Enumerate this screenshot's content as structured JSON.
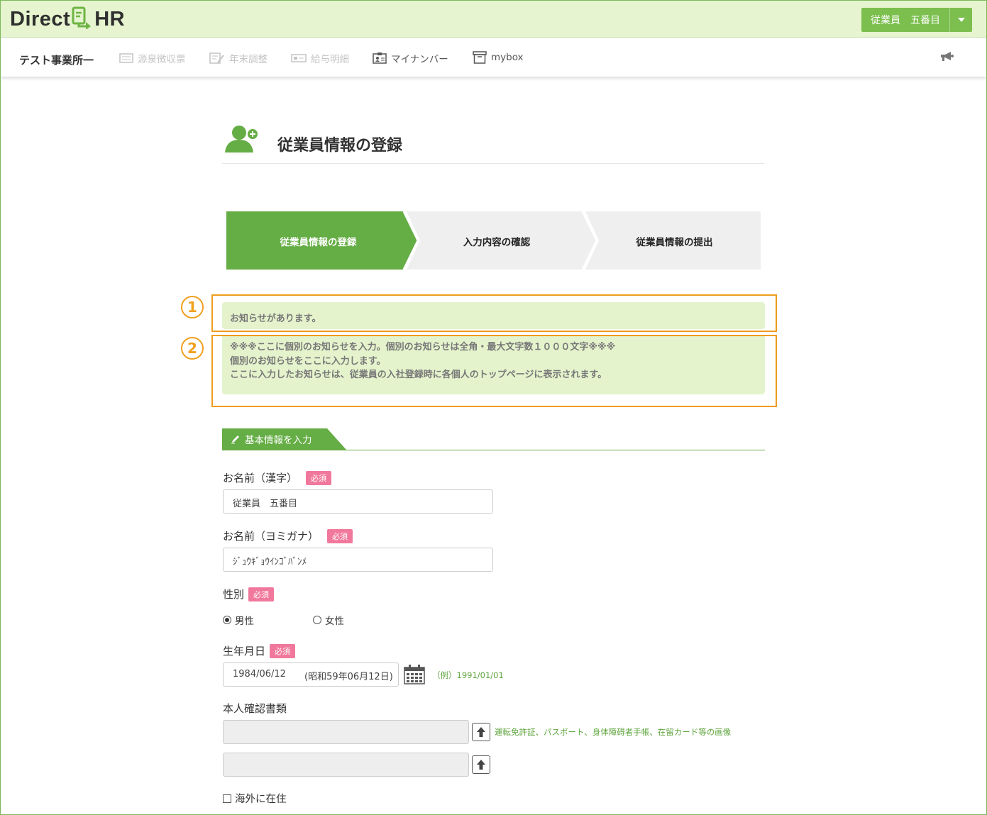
{
  "header": {
    "logo_left": "Direct",
    "logo_right": "HR",
    "user_name": "従業員　五番目"
  },
  "nav": {
    "brand": "テスト事業所一",
    "items": [
      {
        "label": "源泉徴収票",
        "icon": "receipt-icon",
        "enabled": false
      },
      {
        "label": "年末調整",
        "icon": "document-edit-icon",
        "enabled": false
      },
      {
        "label": "給与明細",
        "icon": "payslip-icon",
        "enabled": false
      },
      {
        "label": "マイナンバー",
        "icon": "id-card-icon",
        "enabled": true
      },
      {
        "label": "mybox",
        "icon": "box-icon",
        "enabled": true
      }
    ]
  },
  "page": {
    "title": "従業員情報の登録"
  },
  "steps": [
    {
      "label": "従業員情報の登録",
      "active": true
    },
    {
      "label": "入力内容の確認",
      "active": false
    },
    {
      "label": "従業員情報の提出",
      "active": false
    }
  ],
  "notices": {
    "marker1": "1",
    "marker2": "2",
    "header": "お知らせがあります。",
    "lines": [
      "※※※ここに個別のお知らせを入力。個別のお知らせは全角・最大文字数１０００文字※※※",
      "個別のお知らせをここに入力します。",
      "ここに入力したお知らせは、従業員の入社登録時に各個人のトップページに表示されます。"
    ]
  },
  "section": {
    "title": "基本情報を入力"
  },
  "form": {
    "required_label": "必須",
    "name_kanji": {
      "label": "お名前（漢字）",
      "value": "従業員　五番目"
    },
    "name_kana": {
      "label": "お名前（ヨミガナ）",
      "value": "ｼﾞｭｳｷﾞｮｳｲﾝｺﾞﾊﾞﾝﾒ"
    },
    "gender": {
      "label": "性別",
      "options": [
        "男性",
        "女性"
      ],
      "selected": "男性"
    },
    "birthdate": {
      "label": "生年月日",
      "value": "1984/06/12",
      "era": "(昭和59年06月12日)",
      "example": "（例）1991/01/01"
    },
    "id_docs": {
      "label": "本人確認書類",
      "hint": "運転免許証、パスポート、身体障碍者手帳、在留カード等の画像"
    },
    "overseas": {
      "label": "海外に在住"
    }
  },
  "colors": {
    "accent_green": "#65ad45",
    "header_bg": "#e6f4cf",
    "notice_bg": "#e4f3cc",
    "highlight_orange": "#ef9c1e",
    "required_pink": "#f1789d"
  }
}
